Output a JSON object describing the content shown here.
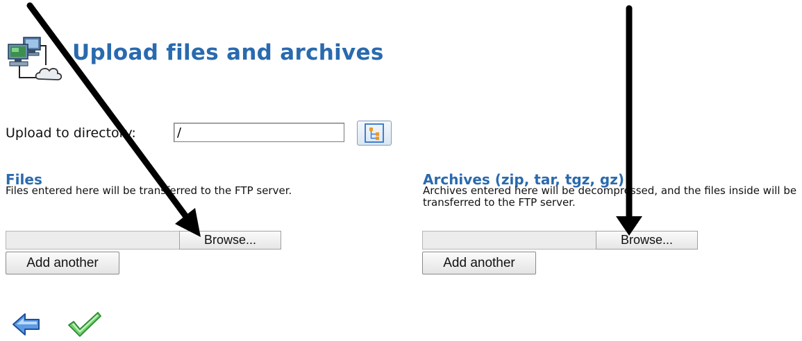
{
  "header": {
    "title": "Upload files and archives",
    "icon": "network-computers-cloud-icon"
  },
  "directory": {
    "label": "Upload to directory:",
    "value": "/",
    "browse_icon": "directory-tree-icon"
  },
  "files_section": {
    "title": "Files",
    "description": "Files entered here will be transferred to the FTP server.",
    "browse_label": "Browse...",
    "add_label": "Add another"
  },
  "archives_section": {
    "title": "Archives (zip, tar, tgz, gz)",
    "description": "Archives entered here will be decompressed, and the files inside will be transferred to the FTP server.",
    "browse_label": "Browse...",
    "add_label": "Add another"
  },
  "footer": {
    "back_icon": "back-arrow-icon",
    "submit_icon": "checkmark-icon"
  },
  "colors": {
    "accent": "#2a6aae",
    "annotation_arrow": "#000000",
    "checkmark": "#3cb043",
    "back_arrow": "#4a8fdc"
  }
}
